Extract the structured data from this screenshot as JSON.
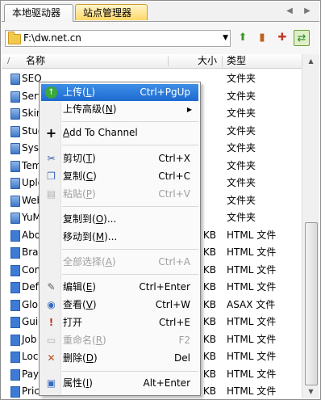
{
  "tabs": [
    {
      "label": "本地驱动器",
      "active": true
    },
    {
      "label": "站点管理器",
      "active": false
    }
  ],
  "path": {
    "value": "F:\\dw.net.cn"
  },
  "columns": {
    "name": "名称",
    "size": "大小",
    "type": "类型"
  },
  "files": [
    {
      "name": "SEO",
      "size": "",
      "type": "文件夹",
      "kind": "folder"
    },
    {
      "name": "Serv",
      "size": "",
      "type": "文件夹",
      "kind": "folder"
    },
    {
      "name": "Skin",
      "size": "",
      "type": "文件夹",
      "kind": "folder"
    },
    {
      "name": "Stud",
      "size": "",
      "type": "文件夹",
      "kind": "folder"
    },
    {
      "name": "Syst",
      "size": "",
      "type": "文件夹",
      "kind": "folder"
    },
    {
      "name": "Tem",
      "size": "",
      "type": "文件夹",
      "kind": "folder"
    },
    {
      "name": "Uplo",
      "size": "",
      "type": "文件夹",
      "kind": "folder"
    },
    {
      "name": "Web",
      "size": "",
      "type": "文件夹",
      "kind": "folder"
    },
    {
      "name": "YuM",
      "size": "",
      "type": "文件夹",
      "kind": "folder"
    },
    {
      "name": "Abo",
      "size": "9 KB",
      "type": "HTML 文件",
      "kind": "file"
    },
    {
      "name": "Brar",
      "size": "5 KB",
      "type": "HTML 文件",
      "kind": "file"
    },
    {
      "name": "Con",
      "size": "9 KB",
      "type": "HTML 文件",
      "kind": "file"
    },
    {
      "name": "Defa",
      "size": "8 KB",
      "type": "HTML 文件",
      "kind": "file"
    },
    {
      "name": "Glol",
      "size": "1 KB",
      "type": "ASAX 文件",
      "kind": "file"
    },
    {
      "name": "Guid",
      "size": "9 KB",
      "type": "HTML 文件",
      "kind": "file"
    },
    {
      "name": "Job",
      "size": "9 KB",
      "type": "HTML 文件",
      "kind": "file"
    },
    {
      "name": "Loca",
      "size": "9 KB",
      "type": "HTML 文件",
      "kind": "file"
    },
    {
      "name": "Payr",
      "size": "9 KB",
      "type": "HTML 文件",
      "kind": "file"
    },
    {
      "name": "Pric",
      "size": "9 KB",
      "type": "HTML 文件",
      "kind": "file"
    }
  ],
  "menu": {
    "upload": {
      "label_main": "上传",
      "mnemonic": "L",
      "shortcut": "Ctrl+PgUp"
    },
    "upload_adv": {
      "label_main": "上传高级",
      "mnemonic": "N"
    },
    "add_channel": {
      "label_first": "A",
      "label_rest": "dd To Channel"
    },
    "cut": {
      "label_main": "剪切",
      "mnemonic": "T",
      "shortcut": "Ctrl+X"
    },
    "copy": {
      "label_main": "复制",
      "mnemonic": "C",
      "shortcut": "Ctrl+C"
    },
    "paste": {
      "label_main": "粘贴",
      "mnemonic": "P",
      "shortcut": "Ctrl+V"
    },
    "copy_to": {
      "label_main": "复制到",
      "mnemonic": "O",
      "suffix": "..."
    },
    "move_to": {
      "label_main": "移动到",
      "mnemonic": "M",
      "suffix": "..."
    },
    "select_all": {
      "label_main": "全部选择",
      "mnemonic": "A",
      "shortcut": "Ctrl+A"
    },
    "edit": {
      "label_main": "编辑",
      "mnemonic": "E",
      "shortcut": "Ctrl+Enter"
    },
    "view": {
      "label_main": "查看",
      "mnemonic": "V",
      "shortcut": "Ctrl+W"
    },
    "open": {
      "label_main": "打开",
      "shortcut": "Ctrl+E"
    },
    "rename": {
      "label_main": "重命名",
      "mnemonic": "R",
      "shortcut": "F2"
    },
    "delete": {
      "label_main": "删除",
      "mnemonic": "D",
      "shortcut": "Del"
    },
    "properties": {
      "label_main": "属性",
      "mnemonic": "I",
      "shortcut": "Alt+Enter"
    },
    "paren_open": "(",
    "paren_close": ")"
  },
  "colors": {
    "highlight": "#1d6ad0",
    "tab_inactive": "#ffd866"
  }
}
